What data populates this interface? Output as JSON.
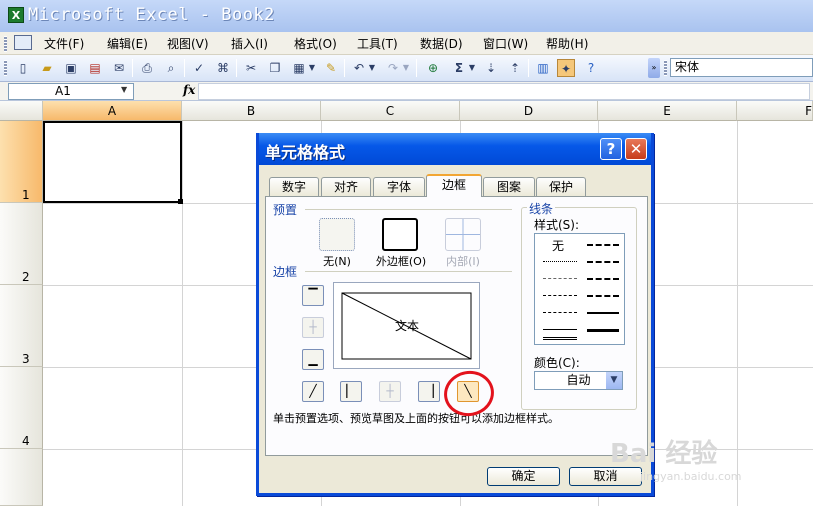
{
  "window": {
    "title": "Microsoft Excel - Book2",
    "app_icon": "X"
  },
  "menu": [
    "文件(F)",
    "编辑(E)",
    "视图(V)",
    "插入(I)",
    "格式(O)",
    "工具(T)",
    "数据(D)",
    "窗口(W)",
    "帮助(H)"
  ],
  "toolbar": {
    "font_name": "宋体"
  },
  "formula_bar": {
    "name_box": "A1",
    "fx": "fx"
  },
  "grid": {
    "columns": [
      "A",
      "B",
      "C",
      "D",
      "E",
      "F"
    ],
    "rows": [
      "1",
      "2",
      "3",
      "4"
    ],
    "selected_cell": "A1"
  },
  "dialog": {
    "title": "单元格格式",
    "help_button": "?",
    "close_button": "✕",
    "tabs": [
      "数字",
      "对齐",
      "字体",
      "边框",
      "图案",
      "保护"
    ],
    "active_tab": "边框",
    "presets_label": "预置",
    "presets": [
      "无(N)",
      "外边框(O)",
      "内部(I)"
    ],
    "border_label": "边框",
    "preview_text": "文本",
    "line_label": "线条",
    "style_label": "样式(S):",
    "style_none": "无",
    "color_label": "颜色(C):",
    "color_value": "自动",
    "hint": "单击预置选项、预览草图及上面的按钮可以添加边框样式。",
    "ok": "确定",
    "cancel": "取消"
  },
  "colors": {
    "dialog_title": "#0658e8",
    "selection_header": "#f7b96b",
    "highlight": "#e3121c"
  },
  "watermark": {
    "brand": "Bai 经验",
    "url": "jingyan.baidu.com"
  }
}
